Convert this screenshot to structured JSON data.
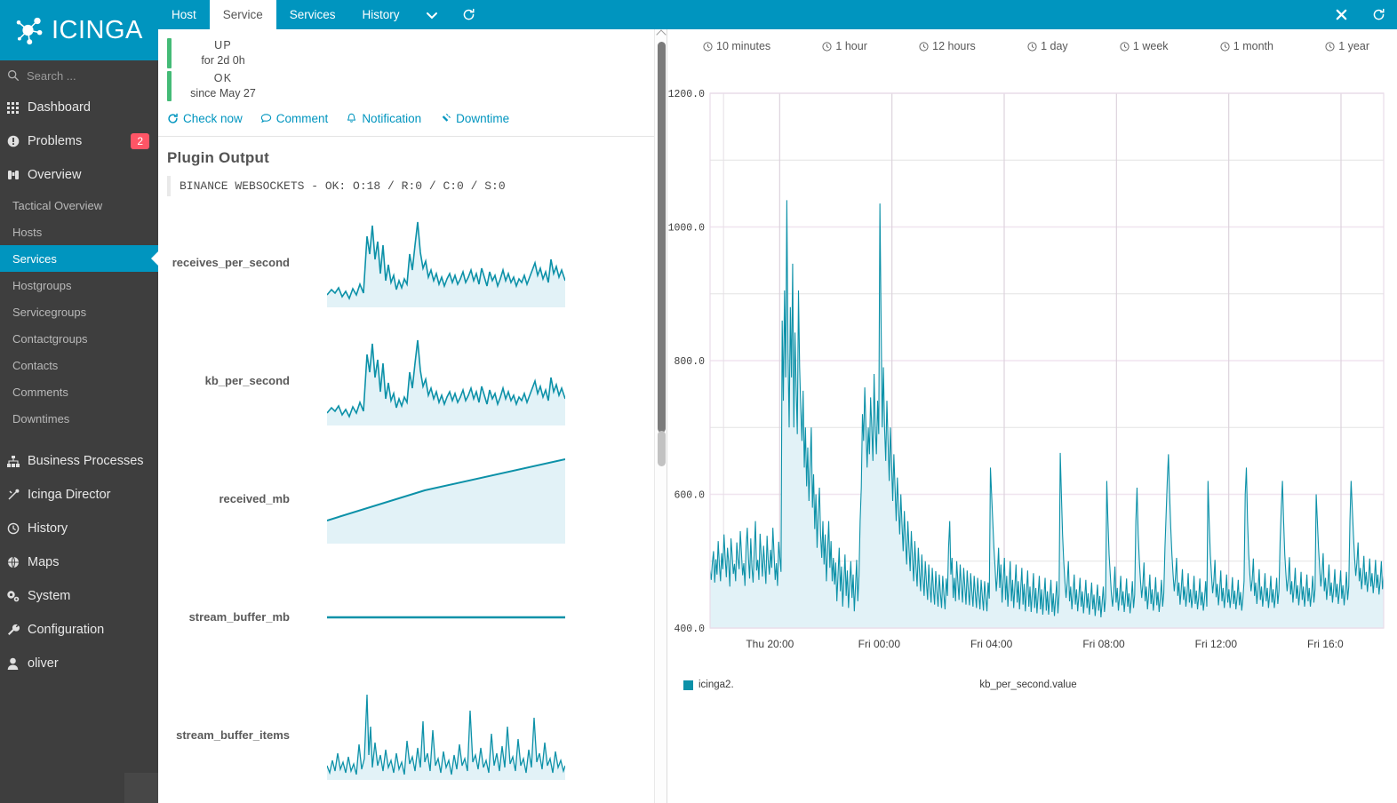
{
  "app": {
    "brand": "ICINGA",
    "accent": "#0095bf",
    "sidebar_bg": "#3e3e3e",
    "badge_color": "#ff5566",
    "status_green": "#44bb77",
    "series_color": "#0c91a8",
    "series_fill": "#e2f2f7"
  },
  "search": {
    "placeholder": "Search ...",
    "value": "",
    "clear_label": "✖"
  },
  "sidebar": {
    "items": [
      {
        "label": "Dashboard",
        "icon": "grid-icon",
        "badge": null,
        "active": false
      },
      {
        "label": "Problems",
        "icon": "exclamation-circle-icon",
        "badge": "2",
        "active": false
      },
      {
        "label": "Overview",
        "icon": "binoculars-icon",
        "badge": null,
        "active": false
      }
    ],
    "overview_children": [
      {
        "label": "Tactical Overview",
        "active": false
      },
      {
        "label": "Hosts",
        "active": false
      },
      {
        "label": "Services",
        "active": true
      },
      {
        "label": "Hostgroups",
        "active": false
      },
      {
        "label": "Servicegroups",
        "active": false
      },
      {
        "label": "Contactgroups",
        "active": false
      },
      {
        "label": "Contacts",
        "active": false
      },
      {
        "label": "Comments",
        "active": false
      },
      {
        "label": "Downtimes",
        "active": false
      }
    ],
    "lower_items": [
      {
        "label": "Business Processes",
        "icon": "sitemap-icon"
      },
      {
        "label": "Icinga Director",
        "icon": "wand-icon"
      },
      {
        "label": "History",
        "icon": "history-clock-icon"
      },
      {
        "label": "Maps",
        "icon": "globe-icon"
      },
      {
        "label": "System",
        "icon": "cogs-icon"
      },
      {
        "label": "Configuration",
        "icon": "wrench-icon"
      },
      {
        "label": "oliver",
        "icon": "user-icon"
      }
    ]
  },
  "tabbar": {
    "tabs": [
      {
        "label": "Host",
        "active": false
      },
      {
        "label": "Service",
        "active": true
      },
      {
        "label": "Services",
        "active": false
      },
      {
        "label": "History",
        "active": false
      }
    ],
    "dropdown_icon": "chevron-down-icon",
    "refresh_icon": "refresh-icon",
    "close_icon": "close-icon",
    "refresh_right_icon": "refresh-icon"
  },
  "detail": {
    "host_state": "UP",
    "host_duration": "for 2d 0h",
    "service_state": "OK",
    "service_since": "since May 27",
    "actions": [
      {
        "label": "Check now",
        "icon": "refresh-icon"
      },
      {
        "label": "Comment",
        "icon": "comment-icon"
      },
      {
        "label": "Notification",
        "icon": "bell-icon"
      },
      {
        "label": "Downtime",
        "icon": "plug-icon"
      }
    ],
    "plugin_output_title": "Plugin Output",
    "plugin_output": "BINANCE WEBSOCKETS - OK: O:18 / R:0 / C:0 / S:0",
    "sparklines": [
      {
        "label": "receives_per_second",
        "shape": "noisy-spiky"
      },
      {
        "label": "kb_per_second",
        "shape": "noisy-spiky"
      },
      {
        "label": "received_mb",
        "shape": "rising-ramp"
      },
      {
        "label": "stream_buffer_mb",
        "shape": "flat-line"
      },
      {
        "label": "stream_buffer_items",
        "shape": "dense-noise"
      }
    ]
  },
  "timeranges": [
    {
      "label": "10 minutes",
      "icon": "clock-icon"
    },
    {
      "label": "1 hour",
      "icon": "clock-icon"
    },
    {
      "label": "12 hours",
      "icon": "clock-icon"
    },
    {
      "label": "1 day",
      "icon": "clock-icon"
    },
    {
      "label": "1 week",
      "icon": "clock-icon"
    },
    {
      "label": "1 month",
      "icon": "clock-icon"
    },
    {
      "label": "1 year",
      "icon": "clock-icon"
    }
  ],
  "chart_data": {
    "type": "area",
    "title": "",
    "xlabel": "kb_per_second.value",
    "ylabel": "",
    "ylim": [
      400.0,
      1200.0
    ],
    "ytick_labels": [
      "1200.0",
      "1000.0",
      "800.0",
      "600.0",
      "400.0"
    ],
    "ytick_values": [
      1200.0,
      1000.0,
      800.0,
      600.0,
      400.0
    ],
    "minor_gridlines": [
      1100.0,
      900.0,
      700.0,
      500.0
    ],
    "grid": true,
    "xtick_labels": [
      "Thu 20:00",
      "Fri 00:00",
      "Fri 04:00",
      "Fri 08:00",
      "Fri 12:00",
      "Fri 16:0"
    ],
    "legend": [
      {
        "name": "icinga2.",
        "color": "#0c91a8"
      }
    ],
    "legend_position": "bottom-left",
    "series": [
      {
        "name": "kb_per_second.value",
        "color": "#0c91a8",
        "fill": "#e2f2f7",
        "values": [
          487,
          472,
          498,
          515,
          468,
          503,
          480,
          530,
          495,
          470,
          512,
          488,
          540,
          505,
          476,
          520,
          498,
          462,
          534,
          509,
          481,
          496,
          470,
          528,
          503,
          488,
          545,
          512,
          479,
          497,
          463,
          522,
          550,
          505,
          474,
          534,
          491,
          468,
          516,
          560,
          486,
          502,
          472,
          541,
          508,
          477,
          523,
          495,
          466,
          538,
          501,
          480,
          517,
          490,
          550,
          512,
          472,
          497,
          463,
          529,
          505,
          484,
          860,
          740,
          905,
          775,
          1040,
          812,
          700,
          880,
          775,
          945,
          700,
          842,
          760,
          690,
          905,
          790,
          728,
          680,
          755,
          640,
          700,
          612,
          670,
          590,
          645,
          700,
          580,
          630,
          548,
          600,
          520,
          572,
          610,
          540,
          505,
          560,
          495,
          540,
          470,
          515,
          560,
          490,
          530,
          470,
          505,
          465,
          498,
          440,
          480,
          520,
          455,
          492,
          432,
          470,
          510,
          448,
          486,
          430,
          468,
          500,
          445,
          480,
          425,
          462,
          502,
          440,
          478,
          560,
          610,
          720,
          680,
          760,
          700,
          640,
          700,
          660,
          745,
          700,
          650,
          780,
          700,
          660,
          740,
          690,
          1035,
          860,
          700,
          790,
          700,
          650,
          740,
          680,
          620,
          700,
          645,
          590,
          660,
          610,
          560,
          625,
          580,
          540,
          600,
          555,
          515,
          575,
          530,
          495,
          560,
          520,
          485,
          545,
          505,
          470,
          530,
          492,
          462,
          520,
          485,
          455,
          510,
          475,
          448,
          500,
          468,
          442,
          495,
          462,
          438,
          490,
          458,
          435,
          485,
          455,
          432,
          480,
          452,
          430,
          478,
          450,
          428,
          474,
          448,
          520,
          560,
          480,
          505,
          445,
          475,
          440,
          500,
          470,
          442,
          495,
          465,
          438,
          490,
          462,
          435,
          486,
          458,
          434,
          482,
          455,
          432,
          478,
          452,
          430,
          475,
          450,
          428,
          472,
          448,
          426,
          470,
          446,
          425,
          468,
          444,
          640,
          600,
          560,
          520,
          490,
          455,
          480,
          520,
          460,
          495,
          438,
          470,
          505,
          442,
          478,
          432,
          465,
          500,
          440,
          472,
          430,
          462,
          495,
          438,
          470,
          428,
          458,
          490,
          435,
          466,
          425,
          455,
          486,
          432,
          462,
          424,
          452,
          482,
          430,
          460,
          422,
          450,
          478,
          428,
          458,
          420,
          448,
          475,
          426,
          455,
          420,
          446,
          472,
          424,
          452,
          418,
          444,
          470,
          422,
          450,
          662,
          600,
          540,
          500,
          470,
          445,
          468,
          500,
          440,
          462,
          428,
          452,
          480,
          435,
          458,
          425,
          448,
          475,
          432,
          455,
          422,
          445,
          472,
          430,
          452,
          420,
          442,
          468,
          428,
          450,
          418,
          440,
          465,
          426,
          448,
          416,
          438,
          462,
          424,
          445,
          620,
          560,
          510,
          480,
          450,
          432,
          455,
          492,
          438,
          460,
          426,
          448,
          478,
          434,
          455,
          424,
          445,
          474,
          432,
          452,
          422,
          442,
          470,
          430,
          450,
          560,
          610,
          540,
          500,
          470,
          445,
          465,
          498,
          440,
          462,
          428,
          450,
          480,
          436,
          458,
          426,
          446,
          476,
          434,
          454,
          424,
          444,
          472,
          432,
          452,
          520,
          570,
          620,
          660,
          600,
          550,
          510,
          480,
          455,
          475,
          505,
          448,
          468,
          435,
          458,
          488,
          442,
          462,
          432,
          452,
          482,
          438,
          458,
          430,
          448,
          478,
          436,
          456,
          428,
          446,
          474,
          434,
          454,
          426,
          444,
          470,
          432,
          620,
          560,
          510,
          480,
          452,
          470,
          502,
          446,
          466,
          434,
          456,
          486,
          440,
          460,
          430,
          450,
          480,
          438,
          458,
          430,
          448,
          476,
          436,
          456,
          428,
          446,
          472,
          434,
          454,
          426,
          444,
          470,
          600,
          640,
          560,
          510,
          480,
          455,
          472,
          504,
          448,
          468,
          436,
          458,
          488,
          442,
          462,
          432,
          452,
          482,
          440,
          460,
          430,
          450,
          478,
          438,
          458,
          430,
          448,
          475,
          436,
          456,
          530,
          580,
          620,
          560,
          510,
          480,
          455,
          474,
          506,
          450,
          470,
          438,
          460,
          490,
          444,
          464,
          434,
          454,
          484,
          442,
          462,
          432,
          452,
          480,
          440,
          460,
          432,
          450,
          478,
          438,
          458,
          600,
          560,
          520,
          490,
          462,
          482,
          512,
          455,
          475,
          442,
          465,
          495,
          448,
          468,
          438,
          458,
          488,
          446,
          466,
          436,
          456,
          486,
          444,
          464,
          434,
          454,
          484,
          442,
          462,
          560,
          620,
          580,
          540,
          505,
          478,
          498,
          528,
          470,
          490,
          458,
          478,
          508,
          464,
          484,
          454,
          474,
          504,
          462,
          482,
          452,
          472,
          502,
          460,
          480,
          450,
          470,
          500,
          458,
          478
        ]
      }
    ]
  }
}
